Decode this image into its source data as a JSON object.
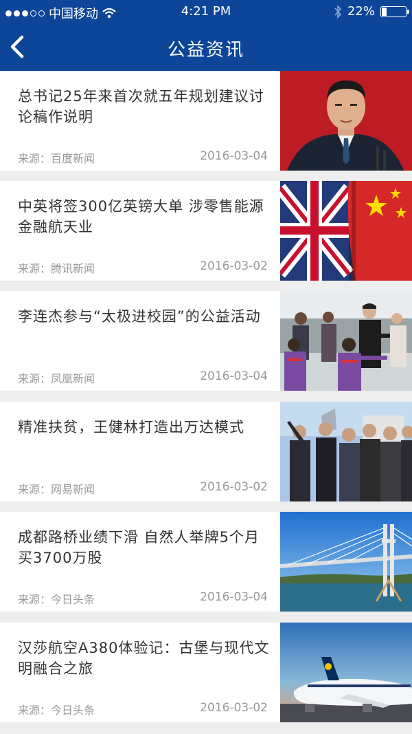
{
  "status_bar": {
    "carrier": "中国移动",
    "time": "4:21 PM",
    "battery": "22%",
    "battery_level": 0.22,
    "icons": [
      "signal-dots",
      "wifi-icon",
      "bluetooth-icon",
      "battery-icon"
    ]
  },
  "nav": {
    "title": "公益资讯",
    "back_icon": "chevron-left-icon"
  },
  "theme": {
    "header_bg": "#0d4699",
    "page_bg": "#eeeeee",
    "text_main": "#333333",
    "text_meta": "#999999"
  },
  "news": [
    {
      "title": "总书记25年来首次就五年规划建议讨论稿作说明",
      "source": "来源：百度新闻",
      "date": "2016-03-04",
      "image": "portrait-photo"
    },
    {
      "title": "中英将签300亿英镑大单 涉零售能源金融航天业",
      "source": "来源：腾讯新闻",
      "date": "2016-03-02",
      "image": "flags-photo"
    },
    {
      "title": "李连杰参与“太极进校园”的公益活动",
      "source": "来源：凤凰新闻",
      "date": "2016-03-04",
      "image": "taichi-photo"
    },
    {
      "title": "精准扶贫，王健林打造出万达模式",
      "source": "来源：网易新闻",
      "date": "2016-03-02",
      "image": "group-photo"
    },
    {
      "title": "成都路桥业绩下滑 自然人举牌5个月买3700万股",
      "source": "来源：今日头条",
      "date": "2016-03-04",
      "image": "bridge-photo"
    },
    {
      "title": "汉莎航空A380体验记：古堡与现代文明融合之旅",
      "source": "来源：今日头条",
      "date": "2016-03-02",
      "image": "airplane-photo"
    }
  ]
}
